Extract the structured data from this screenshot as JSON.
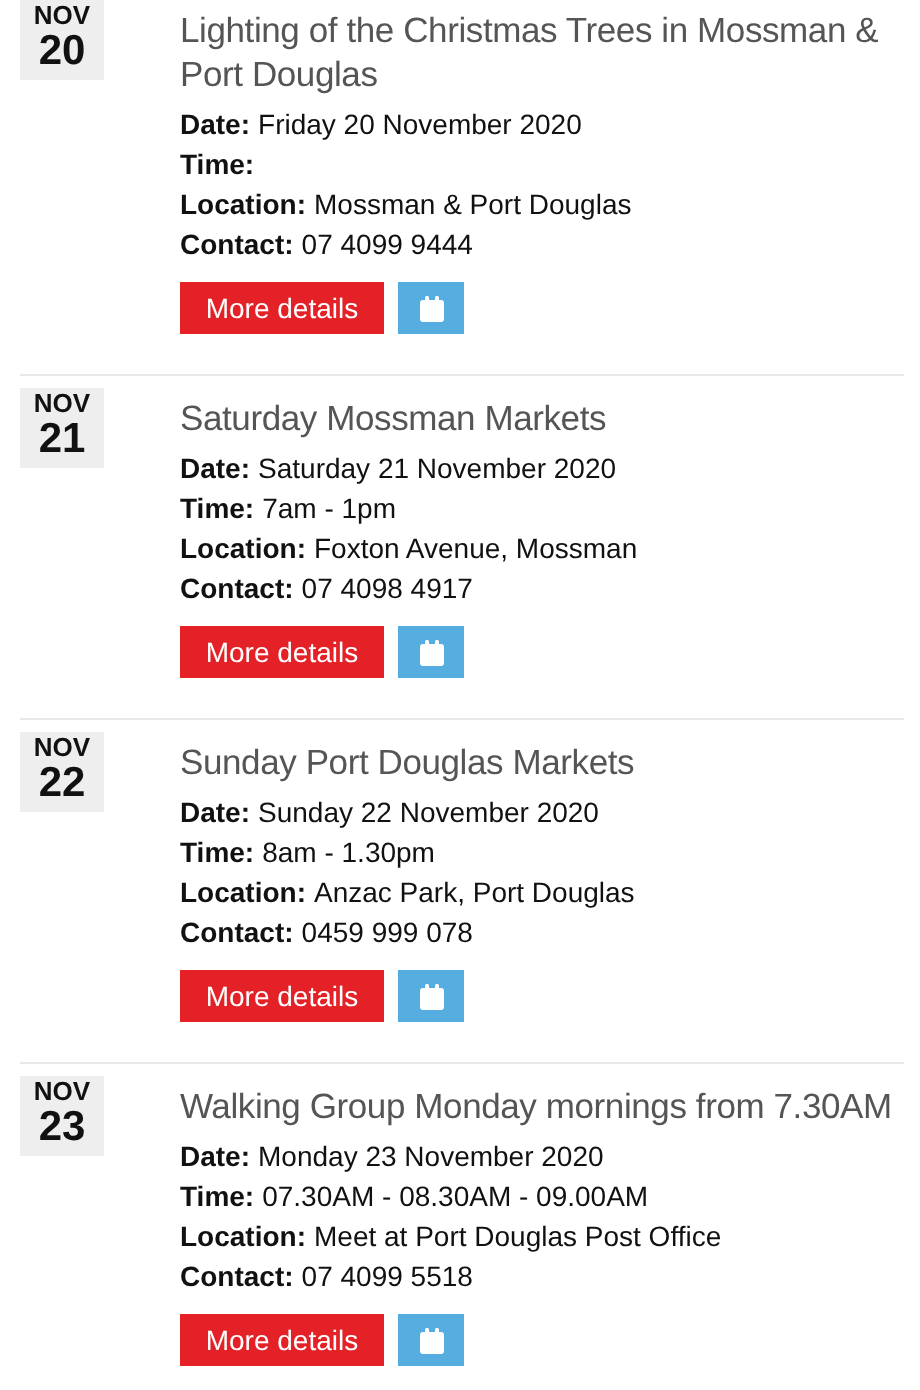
{
  "events": [
    {
      "month": "NOV",
      "day": "20",
      "title": "Lighting of the Christmas Trees in Mossman & Port Douglas",
      "details": [
        {
          "label": "Date:",
          "value": "Friday 20 November 2020"
        },
        {
          "label": "Time:"
        },
        {
          "label": "Location:",
          "value": "Mossman & Port Douglas"
        },
        {
          "label": "Contact:",
          "value": "07 4099 9444"
        }
      ],
      "button": "More details"
    },
    {
      "month": "NOV",
      "day": "21",
      "title": "Saturday Mossman Markets",
      "details": [
        {
          "label": "Date:",
          "value": "Saturday 21 November 2020"
        },
        {
          "label": "Time:",
          "value": "7am - 1pm"
        },
        {
          "label": "Location:",
          "value": "Foxton Avenue, Mossman"
        },
        {
          "label": "Contact:",
          "value": "07 4098 4917"
        }
      ],
      "button": "More details"
    },
    {
      "month": "NOV",
      "day": "22",
      "title": "Sunday Port Douglas Markets",
      "details": [
        {
          "label": "Date:",
          "value": "Sunday 22 November 2020"
        },
        {
          "label": "Time:",
          "value": "8am - 1.30pm"
        },
        {
          "label": "Location:",
          "value": "Anzac Park, Port Douglas"
        },
        {
          "label": "Contact:",
          "value": "0459 999 078"
        }
      ],
      "button": "More details"
    },
    {
      "month": "NOV",
      "day": "23",
      "title": "Walking Group Monday mornings from 7.30AM",
      "details": [
        {
          "label": "Date:",
          "value": "Monday 23 November 2020"
        },
        {
          "label": "Time:",
          "value": "07.30AM - 08.30AM - 09.00AM"
        },
        {
          "label": "Location:",
          "value": "Meet at Port Douglas Post Office"
        },
        {
          "label": "Contact:",
          "value": "07 4099 5518"
        }
      ],
      "button": "More details"
    }
  ]
}
